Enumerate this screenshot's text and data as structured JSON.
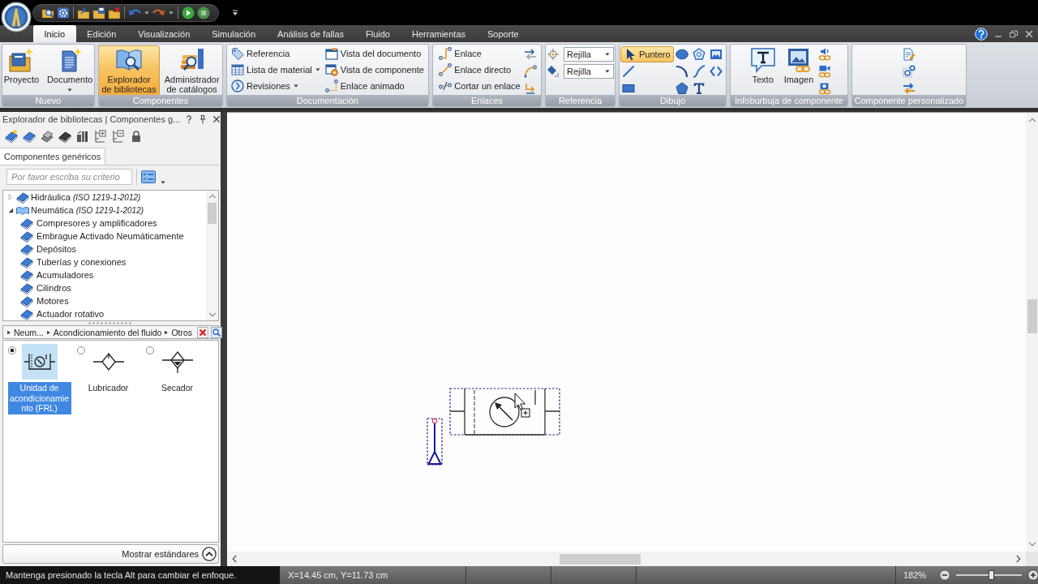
{
  "tabs": [
    {
      "label": "Inicio",
      "selected": true
    },
    {
      "label": "Edición",
      "selected": false
    },
    {
      "label": "Visualización",
      "selected": false
    },
    {
      "label": "Simulación",
      "selected": false
    },
    {
      "label": "Análisis de fallas",
      "selected": false
    },
    {
      "label": "Fluido",
      "selected": false
    },
    {
      "label": "Herramientas",
      "selected": false
    },
    {
      "label": "Soporte",
      "selected": false
    }
  ],
  "ribbon": {
    "groups": [
      {
        "label": "Nuevo",
        "kind": "large",
        "buttons": [
          {
            "label": "Proyecto",
            "dropdown": false
          },
          {
            "label": "Documento",
            "dropdown": true
          }
        ]
      },
      {
        "label": "Componentes",
        "kind": "large",
        "buttons": [
          {
            "label": "Explorador\nde bibliotecas",
            "selected": true
          },
          {
            "label": "Administrador\nde catálogos",
            "selected": false
          }
        ]
      },
      {
        "label": "Documentación",
        "kind": "list",
        "buttons": [
          {
            "label": "Referencia",
            "dropdown": false
          },
          {
            "label": "Lista de material",
            "dropdown": true
          },
          {
            "label": "Revisiones",
            "dropdown": true
          },
          {
            "label": "Vista del documento",
            "dropdown": false
          },
          {
            "label": "Vista de componente",
            "dropdown": false
          },
          {
            "label": "Enlace animado",
            "dropdown": false
          }
        ]
      },
      {
        "label": "Enlaces",
        "kind": "list",
        "buttons": [
          {
            "label": "Enlace"
          },
          {
            "label": "Enlace directo"
          },
          {
            "label": "Cortar un enlace"
          }
        ]
      },
      {
        "label": "Referencia",
        "kind": "selects",
        "selects": [
          {
            "value": "Rejilla"
          },
          {
            "value": "Rejilla"
          }
        ]
      },
      {
        "label": "Dibujo",
        "kind": "tools",
        "tools": [
          {
            "label": "Puntero",
            "selected": true
          },
          {
            "selected": false
          },
          {
            "selected": false
          },
          {
            "selected": false
          },
          {
            "selected": false
          },
          {
            "selected": false
          },
          {
            "selected": false
          },
          {
            "selected": false
          },
          {
            "selected": false
          },
          {
            "selected": false
          },
          {
            "selected": false
          }
        ]
      },
      {
        "label": "Infoburbuja de componente",
        "kind": "large",
        "buttons": [
          {
            "label": "Texto"
          },
          {
            "label": "Imagen"
          }
        ]
      },
      {
        "label": "Componente personalizado",
        "kind": "icons"
      }
    ]
  },
  "library_panel": {
    "title": "Explorador de bibliotecas | Componentes g...",
    "tabs": [
      {
        "label": "Componentes genéricos",
        "selected": true
      }
    ],
    "search": {
      "placeholder": "Por favor escriba su criterio"
    },
    "tree": [
      {
        "label": "Hidráulica *(ISO 1219-1-2012)*",
        "expanded": false
      },
      {
        "label": "Neumática *(ISO 1219-1-2012)*",
        "expanded": true,
        "children": [
          {
            "label": "Compresores y amplificadores"
          },
          {
            "label": "Embrague Activado Neumáticamente"
          },
          {
            "label": "Depósitos"
          },
          {
            "label": "Tuberías y conexiones"
          },
          {
            "label": "Acumuladores"
          },
          {
            "label": "Cilindros"
          },
          {
            "label": "Motores"
          },
          {
            "label": "Actuador rotativo"
          }
        ]
      }
    ],
    "breadcrumb": [
      "Neum...",
      "Acondicionamiento del fluido",
      "Otros"
    ],
    "components": [
      {
        "label": "Unidad de acondicionamiento (FRL)",
        "selected": true
      },
      {
        "label": "Lubricador",
        "selected": false
      },
      {
        "label": "Secador",
        "selected": false
      }
    ],
    "footer_button": "Mostrar estándares"
  },
  "status_bar": {
    "message": "Mantenga presionado la tecla Alt para cambiar el enfoque.",
    "coordinates": "X=14.45 cm, Y=11.73 cm",
    "zoom": "182%",
    "zoom_slider": {
      "level": 0.53
    }
  }
}
